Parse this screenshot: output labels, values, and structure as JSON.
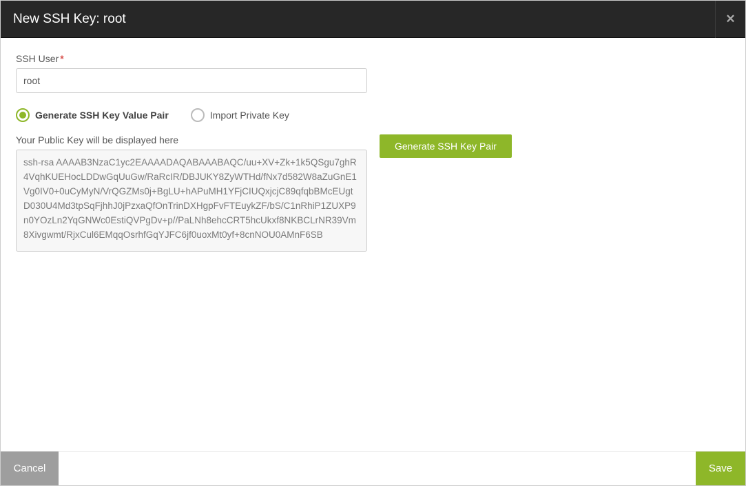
{
  "header": {
    "title": "New SSH Key: root",
    "close_icon": "✕"
  },
  "form": {
    "ssh_user_label": "SSH User",
    "ssh_user_value": "root",
    "radios": {
      "generate_label": "Generate SSH Key Value Pair",
      "import_label": "Import Private Key",
      "selected": "generate"
    },
    "public_key_label": "Your Public Key will be displayed here",
    "public_key_value": "ssh-rsa AAAAB3NzaC1yc2EAAAADAQABAAABAQC/uu+XV+Zk+1k5QSgu7ghR4VqhKUEHocLDDwGqUuGw/RaRcIR/DBJUKY8ZyWTHd/fNx7d582W8aZuGnE1Vg0IV0+0uCyMyN/VrQGZMs0j+BgLU+hAPuMH1YFjCIUQxjcjC89qfqbBMcEUgtD030U4Md3tpSqFjhhJ0jPzxaQfOnTrinDXHgpFvFTEuykZF/bS/C1nRhiP1ZUXP9n0YOzLn2YqGNWc0EstiQVPgDv+p//PaLNh8ehcCRT5hcUkxf8NKBCLrNR39Vm8Xivgwmt/RjxCul6EMqqOsrhfGqYJFC6jf0uoxMt0yf+8cnNOU0AMnF6SB",
    "generate_button": "Generate SSH Key Pair"
  },
  "footer": {
    "cancel": "Cancel",
    "save": "Save"
  }
}
